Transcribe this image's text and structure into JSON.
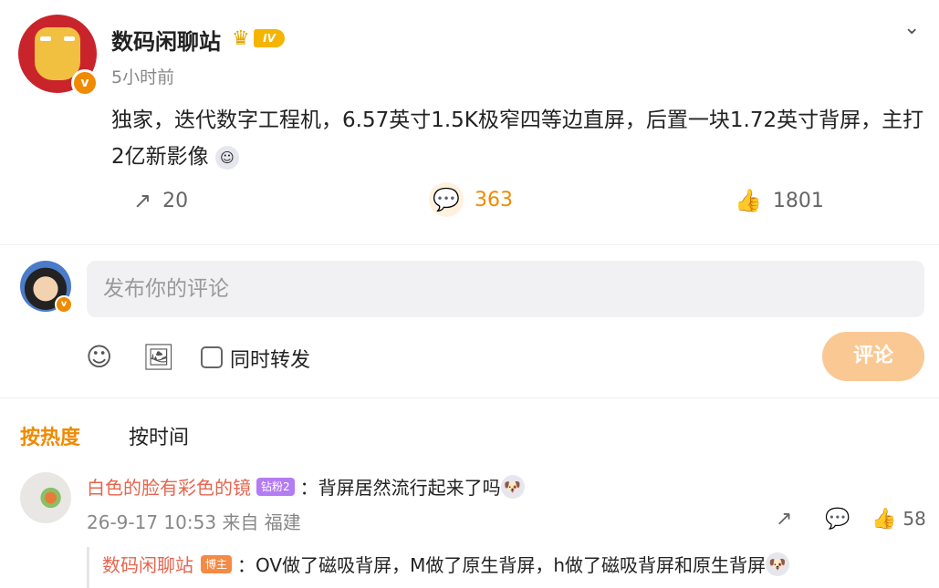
{
  "post": {
    "username": "数码闲聊站",
    "level_badge": "IV",
    "verified_badge": "v",
    "time": "5小时前",
    "text": "独家，迭代数字工程机，6.57英寸1.5K极窄四等边直屏，后置一块1.72英寸背屏，主打2亿新影像",
    "reposts": "20",
    "comments": "363",
    "likes": "1801",
    "icons": [
      "chevron-down-icon",
      "repost-icon",
      "comment-icon",
      "like-icon"
    ]
  },
  "composer": {
    "placeholder": "发布你的评论",
    "forward_label": "同时转发",
    "submit_label": "评论",
    "icons": [
      "emoji-icon",
      "image-icon"
    ]
  },
  "sort": {
    "hot": "按热度",
    "time": "按时间"
  },
  "comments": [
    {
      "user": "白色的脸有彩色的镜",
      "fan_badge": "钻粉2",
      "text": "：背屏居然流行起来了吗",
      "date": "26-9-17 10:53",
      "source": "来自 福建",
      "likes": "58",
      "replies": [
        {
          "user": "数码闲聊站",
          "role_badge": "博主",
          "text": "：OV做了磁吸背屏，M做了原生背屏，h做了磁吸背屏和原生背屏"
        }
      ]
    }
  ],
  "colors": {
    "accent": "#f08a00",
    "submit_bg": "#fac893",
    "name_link": "#e6654e"
  }
}
